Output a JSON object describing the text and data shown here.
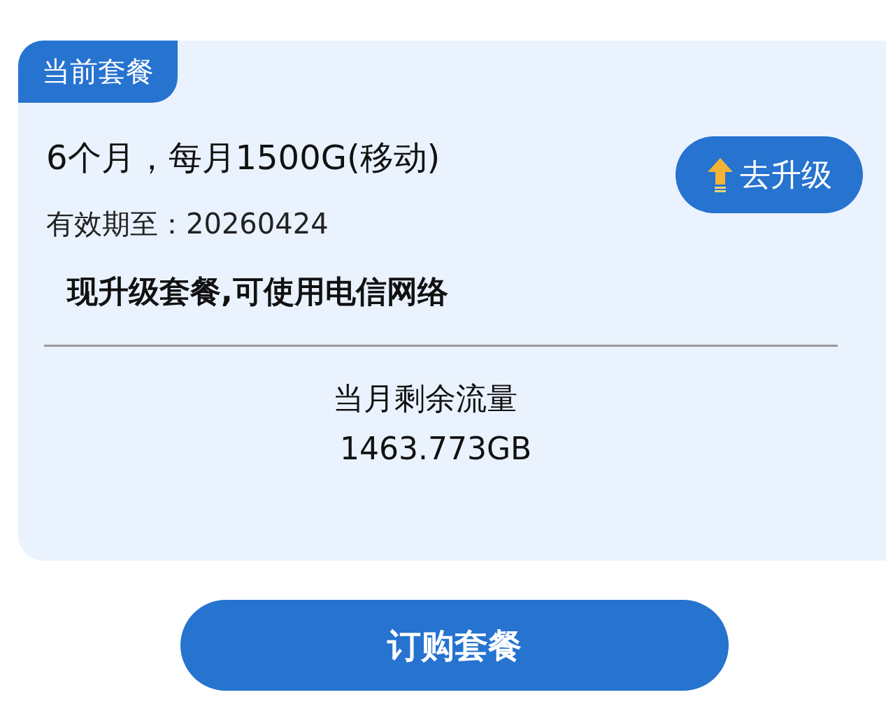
{
  "plan_card": {
    "tag": "当前套餐",
    "title": "6个月，每月1500G(移动)",
    "validity": "有效期至：20260424",
    "upgrade_button": "去升级",
    "notice": "现升级套餐,可使用电信网络",
    "remaining_label": "当月剩余流量",
    "remaining_value": "1463.773GB"
  },
  "order_button": "订购套餐"
}
